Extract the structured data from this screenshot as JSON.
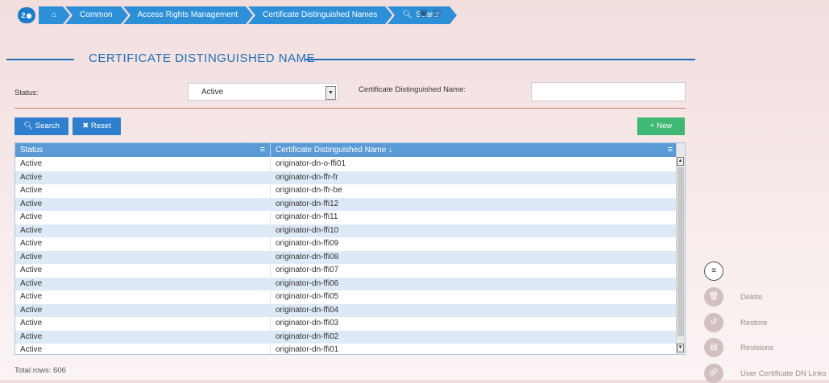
{
  "breadcrumb": {
    "badge": "2",
    "items": [
      "Common",
      "Access Rights Management",
      "Certificate Distinguished Names",
      "Search"
    ]
  },
  "page_title": "CERTIFICATE DISTINGUISHED NAME",
  "filters": {
    "status_label": "Status:",
    "status_value": "Active",
    "cdn_label": "Certificate Distinguished Name:",
    "cdn_value": ""
  },
  "buttons": {
    "search": "Search",
    "reset": "Reset",
    "new": "New"
  },
  "table": {
    "columns": [
      "Status",
      "Certificate Distinguished Name"
    ],
    "cut_top_text": "",
    "rows": [
      [
        "Active",
        "originator-dn-o-ffi01"
      ],
      [
        "Active",
        "originator-dn-ffr-fr"
      ],
      [
        "Active",
        "originator-dn-ffr-be"
      ],
      [
        "Active",
        "originator-dn-ffi12"
      ],
      [
        "Active",
        "originator-dn-ffi11"
      ],
      [
        "Active",
        "originator-dn-ffi10"
      ],
      [
        "Active",
        "originator-dn-ffi09"
      ],
      [
        "Active",
        "originator-dn-ffi08"
      ],
      [
        "Active",
        "originator-dn-ffi07"
      ],
      [
        "Active",
        "originator-dn-ffi06"
      ],
      [
        "Active",
        "originator-dn-ffi05"
      ],
      [
        "Active",
        "originator-dn-ffi04"
      ],
      [
        "Active",
        "originator-dn-ffi03"
      ],
      [
        "Active",
        "originator-dn-ffi02"
      ],
      [
        "Active",
        "originator-dn-ffi01"
      ]
    ]
  },
  "total_rows": "Total rows: 606",
  "actions": {
    "delete": "Delete",
    "restore": "Restore",
    "revisions": "Revisions",
    "user_cert_links": "User Certificate DN Links"
  },
  "colors": {
    "accent_blue": "#2d8fd8",
    "new_green": "#3fb873",
    "header_blue": "#5b9bd5"
  }
}
